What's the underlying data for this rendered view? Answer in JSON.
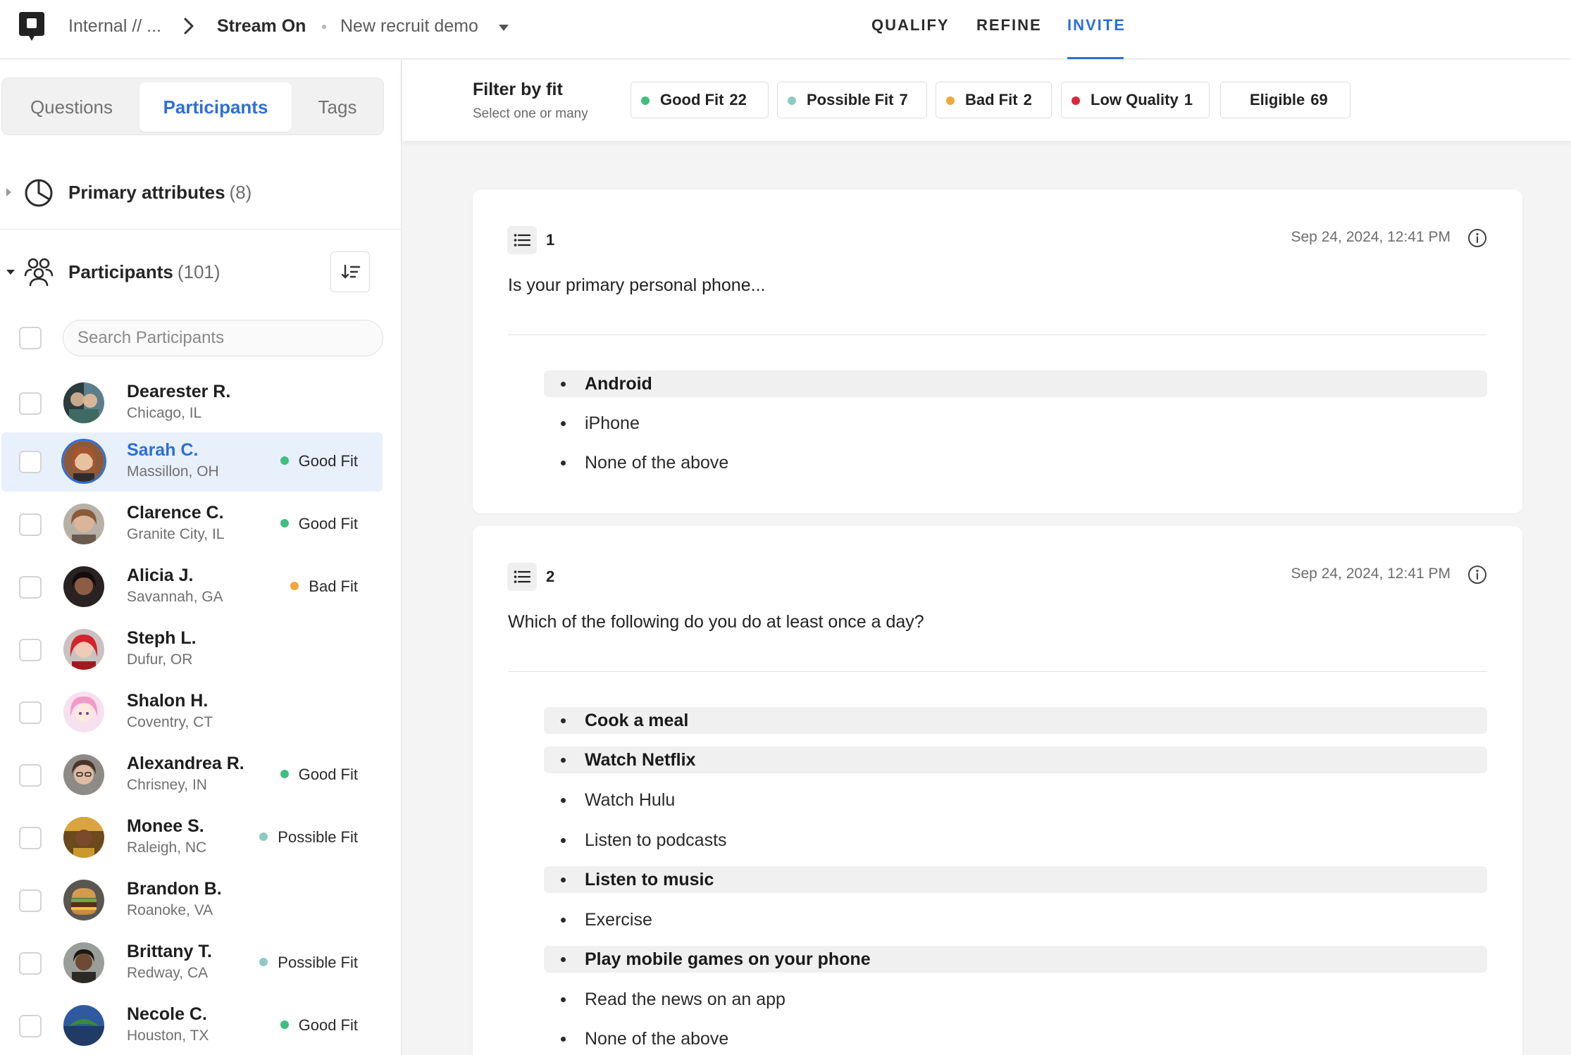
{
  "header": {
    "breadcrumb": {
      "workspace": "Internal // ...",
      "project": "Stream On",
      "study": "New recruit demo"
    },
    "tabs": [
      {
        "label": "QUALIFY",
        "active": false
      },
      {
        "label": "REFINE",
        "active": false
      },
      {
        "label": "INVITE",
        "active": true
      }
    ]
  },
  "sidebar": {
    "segments": [
      {
        "label": "Questions",
        "active": false
      },
      {
        "label": "Participants",
        "active": true
      },
      {
        "label": "Tags",
        "active": false
      }
    ],
    "primary_attributes": {
      "label": "Primary attributes",
      "count": "(8)"
    },
    "participants_section": {
      "label": "Participants",
      "count": "(101)"
    },
    "search": {
      "placeholder": "Search Participants",
      "value": ""
    },
    "participants": [
      {
        "name": "Dearester R.",
        "location": "Chicago, IL",
        "fit": "",
        "fit_color": ""
      },
      {
        "name": "Sarah C.",
        "location": "Massillon, OH",
        "fit": "Good Fit",
        "fit_color": "#3fbf7f",
        "selected": true
      },
      {
        "name": "Clarence C.",
        "location": "Granite City, IL",
        "fit": "Good Fit",
        "fit_color": "#3fbf7f"
      },
      {
        "name": "Alicia J.",
        "location": "Savannah, GA",
        "fit": "Bad Fit",
        "fit_color": "#f0a73a"
      },
      {
        "name": "Steph L.",
        "location": "Dufur, OR",
        "fit": "",
        "fit_color": ""
      },
      {
        "name": "Shalon H.",
        "location": "Coventry, CT",
        "fit": "",
        "fit_color": ""
      },
      {
        "name": "Alexandrea R.",
        "location": "Chrisney, IN",
        "fit": "Good Fit",
        "fit_color": "#3fbf7f"
      },
      {
        "name": "Monee S.",
        "location": "Raleigh, NC",
        "fit": "Possible Fit",
        "fit_color": "#8fc9c5"
      },
      {
        "name": "Brandon B.",
        "location": "Roanoke, VA",
        "fit": "",
        "fit_color": ""
      },
      {
        "name": "Brittany T.",
        "location": "Redway, CA",
        "fit": "Possible Fit",
        "fit_color": "#8fc9c5"
      },
      {
        "name": "Necole C.",
        "location": "Houston, TX",
        "fit": "Good Fit",
        "fit_color": "#3fbf7f"
      }
    ]
  },
  "filter": {
    "title": "Filter by fit",
    "subtitle": "Select one or many",
    "chips": [
      {
        "label": "Good Fit",
        "count": "22",
        "color": "#3fbf7f"
      },
      {
        "label": "Possible Fit",
        "count": "7",
        "color": "#8fc9c5"
      },
      {
        "label": "Bad Fit",
        "count": "2",
        "color": "#f0a73a"
      },
      {
        "label": "Low Quality",
        "count": "1",
        "color": "#d7263d"
      },
      {
        "label": "Eligible",
        "count": "69",
        "color": ""
      }
    ]
  },
  "questions": [
    {
      "number": "1",
      "date": "Sep 24, 2024, 12:41 PM",
      "text": "Is your primary personal phone...",
      "options": [
        {
          "label": "Android",
          "selected": true
        },
        {
          "label": "iPhone",
          "selected": false
        },
        {
          "label": "None of the above",
          "selected": false
        }
      ]
    },
    {
      "number": "2",
      "date": "Sep 24, 2024, 12:41 PM",
      "text": "Which of the following do you do at least once a day?",
      "options": [
        {
          "label": "Cook a meal",
          "selected": true
        },
        {
          "label": "Watch Netflix",
          "selected": true
        },
        {
          "label": "Watch Hulu",
          "selected": false
        },
        {
          "label": "Listen to podcasts",
          "selected": false
        },
        {
          "label": "Listen to music",
          "selected": true
        },
        {
          "label": "Exercise",
          "selected": false
        },
        {
          "label": "Play mobile games on your phone",
          "selected": true
        },
        {
          "label": "Read the news on an app",
          "selected": false
        },
        {
          "label": "None of the above",
          "selected": false
        }
      ]
    }
  ]
}
